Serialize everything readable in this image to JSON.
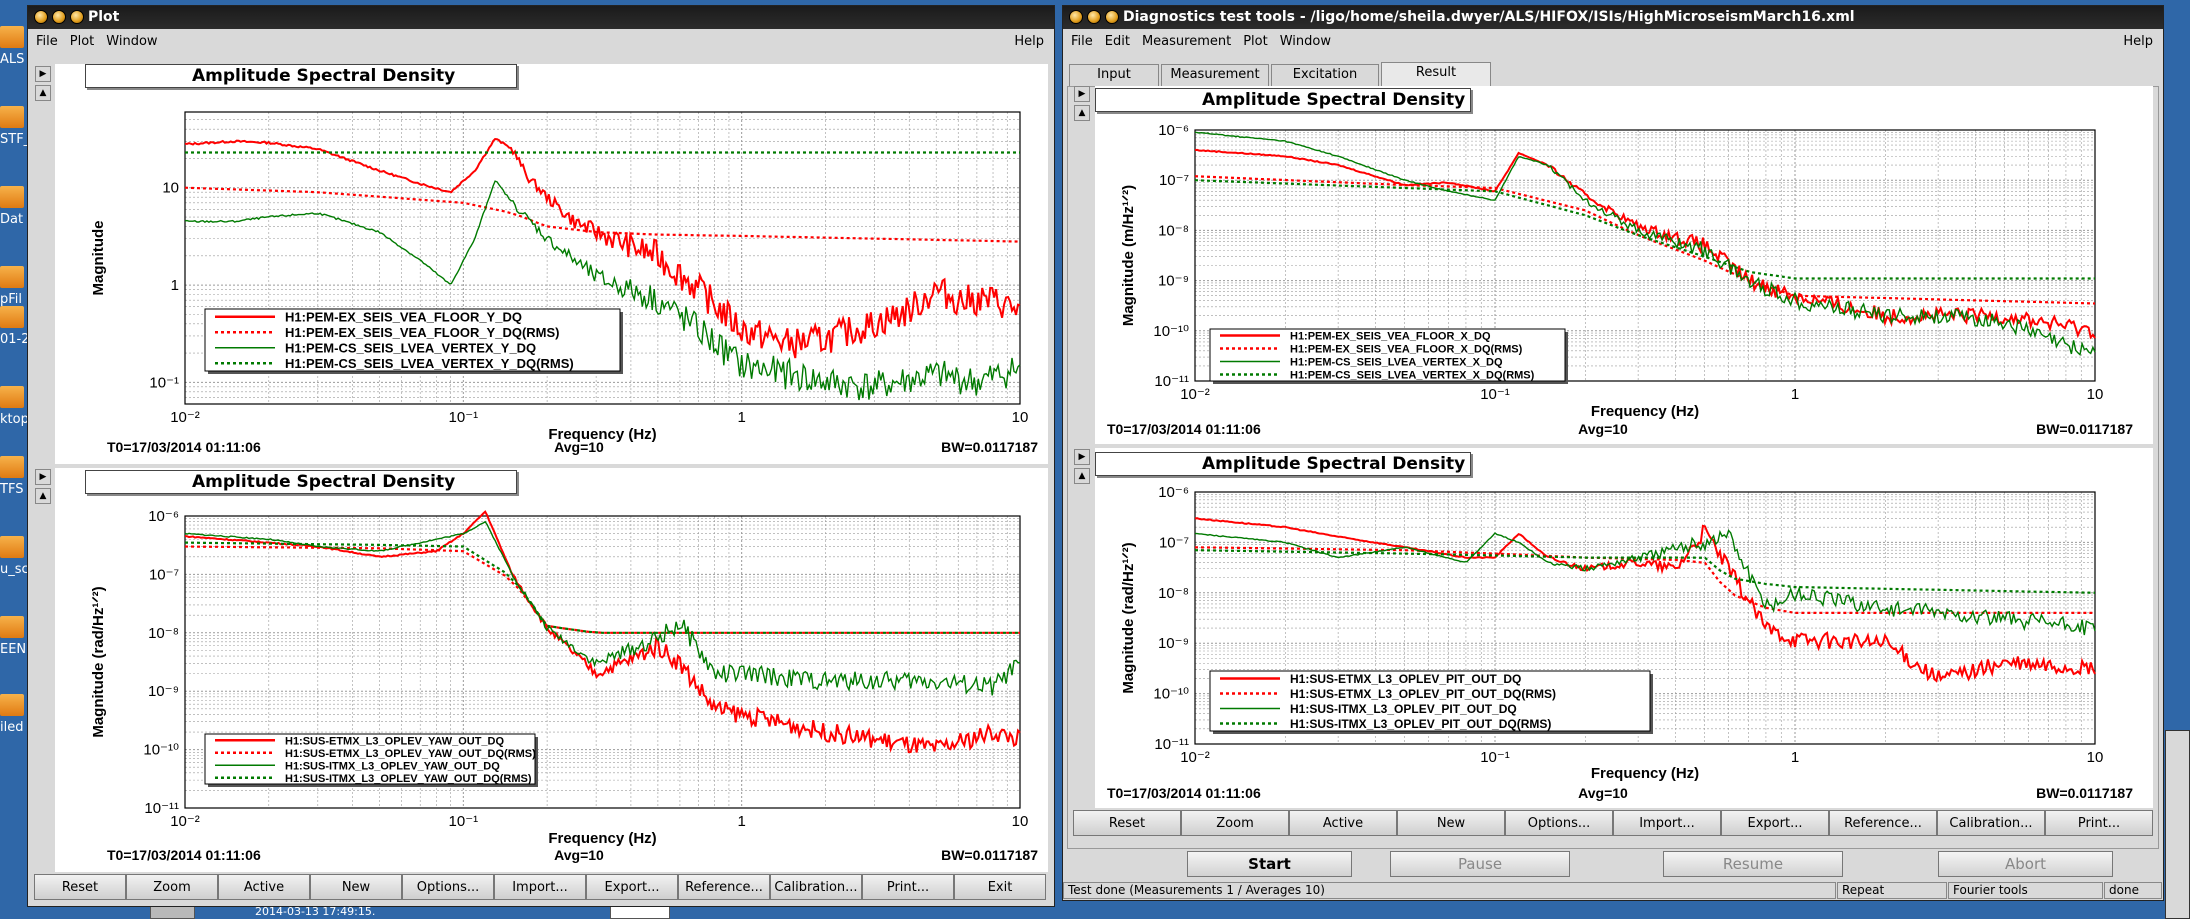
{
  "desktop": {
    "icons": [
      {
        "label": "ALS"
      },
      {
        "label": "STF_"
      },
      {
        "label": "Dat"
      },
      {
        "label": "pFil"
      },
      {
        "label": "01-2"
      },
      {
        "label": "ktop"
      },
      {
        "label": "TFS"
      },
      {
        "label": "u_sc"
      },
      {
        "label": "EENS"
      },
      {
        "label": "iled"
      }
    ],
    "taskbar_text": "2014-03-13 17:49:15."
  },
  "plot_window": {
    "title": "Plot",
    "menu": [
      "File",
      "Plot",
      "Window"
    ],
    "help": "Help",
    "buttons": [
      "Reset",
      "Zoom",
      "Active",
      "New",
      "Options...",
      "Import...",
      "Export...",
      "Reference...",
      "Calibration...",
      "Print...",
      "Exit"
    ],
    "panels": [
      {
        "title": "Amplitude Spectral Density",
        "ylabel": "Magnitude",
        "xlabel": "Frequency (Hz)",
        "yticks": [
          "10",
          "1",
          "10⁻¹"
        ],
        "xticks": [
          "10⁻²",
          "10⁻¹",
          "1",
          "10"
        ],
        "legend": [
          "H1:PEM-EX_SEIS_VEA_FLOOR_Y_DQ",
          "H1:PEM-EX_SEIS_VEA_FLOOR_Y_DQ(RMS)",
          "H1:PEM-CS_SEIS_LVEA_VERTEX_Y_DQ",
          "H1:PEM-CS_SEIS_LVEA_VERTEX_Y_DQ(RMS)"
        ],
        "t0": "T0=17/03/2014 01:11:06",
        "avg": "Avg=10",
        "bw": "BW=0.0117187"
      },
      {
        "title": "Amplitude Spectral Density",
        "ylabel": "Magnitude (rad/Hz¹ᐟ²)",
        "xlabel": "Frequency (Hz)",
        "yticks": [
          "10⁻⁶",
          "10⁻⁷",
          "10⁻⁸",
          "10⁻⁹",
          "10⁻¹⁰",
          "10⁻¹¹"
        ],
        "xticks": [
          "10⁻²",
          "10⁻¹",
          "1",
          "10"
        ],
        "legend": [
          "H1:SUS-ETMX_L3_OPLEV_YAW_OUT_DQ",
          "H1:SUS-ETMX_L3_OPLEV_YAW_OUT_DQ(RMS)",
          "H1:SUS-ITMX_L3_OPLEV_YAW_OUT_DQ",
          "H1:SUS-ITMX_L3_OPLEV_YAW_OUT_DQ(RMS)"
        ],
        "t0": "T0=17/03/2014 01:11:06",
        "avg": "Avg=10",
        "bw": "BW=0.0117187"
      }
    ]
  },
  "dtt_window": {
    "title": "Diagnostics test tools - /ligo/home/sheila.dwyer/ALS/HIFOX/ISIs/HighMicroseismMarch16.xml",
    "menu": [
      "File",
      "Edit",
      "Measurement",
      "Plot",
      "Window"
    ],
    "help": "Help",
    "tabs": [
      "Input",
      "Measurement",
      "Excitation",
      "Result"
    ],
    "buttons": [
      "Reset",
      "Zoom",
      "Active",
      "New",
      "Options...",
      "Import...",
      "Export...",
      "Reference...",
      "Calibration...",
      "Print..."
    ],
    "actions": [
      "Start",
      "Pause",
      "Resume",
      "Abort"
    ],
    "status": [
      "Test done (Measurements 1 / Averages 10)",
      "Repeat",
      "Fourier tools",
      "done"
    ],
    "panels": [
      {
        "title": "Amplitude Spectral Density",
        "ylabel": "Magnitude (m/Hz¹ᐟ²)",
        "xlabel": "Frequency (Hz)",
        "yticks": [
          "10⁻⁶",
          "10⁻⁷",
          "10⁻⁸",
          "10⁻⁹",
          "10⁻¹⁰",
          "10⁻¹¹"
        ],
        "xticks": [
          "10⁻²",
          "10⁻¹",
          "1",
          "10"
        ],
        "legend": [
          "H1:PEM-EX_SEIS_VEA_FLOOR_X_DQ",
          "H1:PEM-EX_SEIS_VEA_FLOOR_X_DQ(RMS)",
          "H1:PEM-CS_SEIS_LVEA_VERTEX_X_DQ",
          "H1:PEM-CS_SEIS_LVEA_VERTEX_X_DQ(RMS)"
        ],
        "t0": "T0=17/03/2014 01:11:06",
        "avg": "Avg=10",
        "bw": "BW=0.0117187"
      },
      {
        "title": "Amplitude Spectral Density",
        "ylabel": "Magnitude (rad/Hz¹ᐟ²)",
        "xlabel": "Frequency (Hz)",
        "yticks": [
          "10⁻⁶",
          "10⁻⁷",
          "10⁻⁸",
          "10⁻⁹",
          "10⁻¹⁰",
          "10⁻¹¹"
        ],
        "xticks": [
          "10⁻²",
          "10⁻¹",
          "1",
          "10"
        ],
        "legend": [
          "H1:SUS-ETMX_L3_OPLEV_PIT_OUT_DQ",
          "H1:SUS-ETMX_L3_OPLEV_PIT_OUT_DQ(RMS)",
          "H1:SUS-ITMX_L3_OPLEV_PIT_OUT_DQ",
          "H1:SUS-ITMX_L3_OPLEV_PIT_OUT_DQ(RMS)"
        ],
        "t0": "T0=17/03/2014 01:11:06",
        "avg": "Avg=10",
        "bw": "BW=0.0117187"
      }
    ]
  },
  "colors": {
    "red": "#ff0000",
    "green": "#007a00",
    "grid": "#9a9a9a"
  },
  "chart_data": [
    {
      "type": "line",
      "title": "Amplitude Spectral Density",
      "xlabel": "Frequency (Hz)",
      "ylabel": "Magnitude",
      "xscale": "log",
      "yscale": "log",
      "xlim": [
        0.01,
        10
      ],
      "ylim": [
        0.06,
        60
      ],
      "series": [
        {
          "name": "H1:PEM-EX_SEIS_VEA_FLOOR_Y_DQ",
          "style": "solid",
          "color": "red",
          "x": [
            0.01,
            0.015,
            0.02,
            0.03,
            0.05,
            0.07,
            0.09,
            0.11,
            0.13,
            0.15,
            0.17,
            0.2,
            0.25,
            0.3,
            0.4,
            0.5,
            0.7,
            1.0,
            1.5,
            2,
            3,
            4,
            5,
            6,
            8,
            10
          ],
          "y": [
            28,
            30,
            29,
            25,
            15,
            11,
            9,
            15,
            32,
            25,
            13,
            8,
            4.5,
            3.5,
            2.5,
            2,
            0.9,
            0.35,
            0.25,
            0.28,
            0.4,
            0.55,
            0.9,
            0.7,
            0.7,
            0.55
          ]
        },
        {
          "name": "H1:PEM-EX_SEIS_VEA_FLOOR_Y_DQ(RMS)",
          "style": "dotted",
          "color": "red",
          "x": [
            0.01,
            0.03,
            0.1,
            0.15,
            0.2,
            0.3,
            0.5,
            1,
            3,
            10
          ],
          "y": [
            10,
            9,
            7,
            5.5,
            4,
            3.5,
            3.3,
            3.2,
            3.0,
            2.8
          ]
        },
        {
          "name": "H1:PEM-CS_SEIS_LVEA_VERTEX_Y_DQ",
          "style": "solid",
          "color": "green",
          "x": [
            0.01,
            0.015,
            0.02,
            0.03,
            0.05,
            0.07,
            0.09,
            0.11,
            0.13,
            0.15,
            0.2,
            0.3,
            0.5,
            0.7,
            1,
            1.5,
            2,
            3,
            5,
            7,
            10
          ],
          "y": [
            4.5,
            4.5,
            5,
            5.5,
            3.5,
            1.8,
            1,
            3,
            12,
            7,
            3,
            1.2,
            0.7,
            0.35,
            0.15,
            0.12,
            0.1,
            0.09,
            0.12,
            0.1,
            0.14
          ]
        },
        {
          "name": "H1:PEM-CS_SEIS_LVEA_VERTEX_Y_DQ(RMS)",
          "style": "dotted",
          "color": "green",
          "x": [
            0.01,
            1,
            10
          ],
          "y": [
            23,
            23,
            23
          ]
        }
      ]
    },
    {
      "type": "line",
      "title": "Amplitude Spectral Density",
      "xlabel": "Frequency (Hz)",
      "ylabel": "Magnitude (rad/Hz¹ᐟ²)",
      "xscale": "log",
      "yscale": "log",
      "xlim": [
        0.01,
        10
      ],
      "ylim": [
        1e-11,
        1e-06
      ],
      "series": [
        {
          "name": "H1:SUS-ETMX_L3_OPLEV_YAW_OUT_DQ",
          "style": "solid",
          "color": "red",
          "x": [
            0.01,
            0.02,
            0.03,
            0.05,
            0.08,
            0.1,
            0.12,
            0.15,
            0.2,
            0.3,
            0.4,
            0.5,
            0.6,
            0.8,
            1,
            2,
            3,
            5,
            8,
            10
          ],
          "y": [
            4.5e-07,
            3.5e-07,
            3e-07,
            2e-07,
            2.5e-07,
            5e-07,
            1.2e-06,
            1e-07,
            1.2e-08,
            2e-09,
            3.5e-09,
            6e-09,
            3e-09,
            5e-10,
            4e-10,
            2e-10,
            1.5e-10,
            1e-10,
            2e-10,
            1.5e-10
          ]
        },
        {
          "name": "H1:SUS-ETMX_L3_OPLEV_YAW_OUT_DQ(RMS)",
          "style": "dotted",
          "color": "red",
          "x": [
            0.01,
            0.05,
            0.1,
            0.15,
            0.2,
            0.3,
            1,
            10
          ],
          "y": [
            3e-07,
            2.8e-07,
            2.5e-07,
            8e-08,
            1.3e-08,
            1e-08,
            1e-08,
            1e-08
          ]
        },
        {
          "name": "H1:SUS-ITMX_L3_OPLEV_YAW_OUT_DQ",
          "style": "solid",
          "color": "green",
          "x": [
            0.01,
            0.02,
            0.03,
            0.05,
            0.08,
            0.1,
            0.12,
            0.15,
            0.2,
            0.3,
            0.5,
            0.6,
            0.8,
            1,
            2,
            3,
            5,
            8,
            10
          ],
          "y": [
            5e-07,
            4e-07,
            3e-07,
            2.5e-07,
            4e-07,
            5e-07,
            8e-07,
            1e-07,
            1.2e-08,
            3e-09,
            8e-09,
            1.5e-08,
            2e-09,
            2e-09,
            1.5e-09,
            1.5e-09,
            1.5e-09,
            1.2e-09,
            3e-09
          ]
        },
        {
          "name": "H1:SUS-ITMX_L3_OPLEV_YAW_OUT_DQ(RMS)",
          "style": "dotted",
          "color": "green",
          "x": [
            0.01,
            0.05,
            0.1,
            0.15,
            0.2,
            0.3,
            1,
            10
          ],
          "y": [
            3.5e-07,
            3.2e-07,
            3e-07,
            9e-08,
            1.3e-08,
            1e-08,
            1e-08,
            1e-08
          ]
        }
      ]
    },
    {
      "type": "line",
      "title": "Amplitude Spectral Density",
      "xlabel": "Frequency (Hz)",
      "ylabel": "Magnitude (m/Hz¹ᐟ²)",
      "xscale": "log",
      "yscale": "log",
      "xlim": [
        0.01,
        10
      ],
      "ylim": [
        1e-11,
        1e-06
      ],
      "series": [
        {
          "name": "H1:PEM-EX_SEIS_VEA_FLOOR_X_DQ",
          "style": "solid",
          "color": "red",
          "x": [
            0.01,
            0.02,
            0.03,
            0.05,
            0.07,
            0.1,
            0.12,
            0.15,
            0.2,
            0.3,
            0.5,
            0.7,
            1,
            2,
            3,
            5,
            10
          ],
          "y": [
            4e-07,
            3e-07,
            2e-07,
            8e-08,
            9e-08,
            6e-08,
            3.5e-07,
            2e-07,
            5e-08,
            1.2e-08,
            5e-09,
            1e-09,
            5e-10,
            2e-10,
            2e-10,
            2e-10,
            1e-10
          ]
        },
        {
          "name": "H1:PEM-EX_SEIS_VEA_FLOOR_X_DQ(RMS)",
          "style": "dotted",
          "color": "red",
          "x": [
            0.01,
            0.05,
            0.1,
            0.2,
            0.3,
            0.5,
            0.7,
            1,
            10
          ],
          "y": [
            1.2e-07,
            8e-08,
            7e-08,
            2.5e-08,
            8e-09,
            2.5e-09,
            1e-09,
            5e-10,
            3.5e-10
          ]
        },
        {
          "name": "H1:PEM-CS_SEIS_LVEA_VERTEX_X_DQ",
          "style": "solid",
          "color": "green",
          "x": [
            0.01,
            0.02,
            0.03,
            0.05,
            0.07,
            0.1,
            0.12,
            0.15,
            0.2,
            0.3,
            0.5,
            0.7,
            1,
            2,
            3,
            5,
            8,
            10
          ],
          "y": [
            9e-07,
            6e-07,
            3e-07,
            1e-07,
            6e-08,
            4e-08,
            3e-07,
            2e-07,
            4e-08,
            1e-08,
            4e-09,
            1e-09,
            4e-10,
            2e-10,
            2e-10,
            1.5e-10,
            5e-11,
            4e-11
          ]
        },
        {
          "name": "H1:PEM-CS_SEIS_LVEA_VERTEX_X_DQ(RMS)",
          "style": "dotted",
          "color": "green",
          "x": [
            0.01,
            0.05,
            0.1,
            0.2,
            0.3,
            0.5,
            0.7,
            1,
            10
          ],
          "y": [
            1e-07,
            7e-08,
            6e-08,
            2e-08,
            8e-09,
            3e-09,
            1.5e-09,
            1.1e-09,
            1.1e-09
          ]
        }
      ]
    },
    {
      "type": "line",
      "title": "Amplitude Spectral Density",
      "xlabel": "Frequency (Hz)",
      "ylabel": "Magnitude (rad/Hz¹ᐟ²)",
      "xscale": "log",
      "yscale": "log",
      "xlim": [
        0.01,
        10
      ],
      "ylim": [
        1e-11,
        1e-06
      ],
      "series": [
        {
          "name": "H1:SUS-ETMX_L3_OPLEV_PIT_OUT_DQ",
          "style": "solid",
          "color": "red",
          "x": [
            0.01,
            0.02,
            0.03,
            0.05,
            0.08,
            0.1,
            0.12,
            0.15,
            0.2,
            0.3,
            0.4,
            0.5,
            0.6,
            0.8,
            1,
            2,
            3,
            5,
            10
          ],
          "y": [
            3e-07,
            2e-07,
            1.3e-07,
            8e-08,
            5e-08,
            5e-08,
            1.5e-07,
            5e-08,
            3e-08,
            4e-08,
            3e-08,
            1.7e-07,
            3e-08,
            2e-09,
            1.2e-09,
            1e-09,
            2e-10,
            4e-10,
            3e-10
          ]
        },
        {
          "name": "H1:SUS-ETMX_L3_OPLEV_PIT_OUT_DQ(RMS)",
          "style": "dotted",
          "color": "red",
          "x": [
            0.01,
            0.05,
            0.1,
            0.2,
            0.4,
            0.5,
            0.6,
            0.8,
            1,
            10
          ],
          "y": [
            8e-08,
            7e-08,
            6e-08,
            5e-08,
            4.5e-08,
            4e-08,
            1e-08,
            5e-09,
            4e-09,
            4e-09
          ]
        },
        {
          "name": "H1:SUS-ITMX_L3_OPLEV_PIT_OUT_DQ",
          "style": "solid",
          "color": "green",
          "x": [
            0.01,
            0.02,
            0.03,
            0.05,
            0.08,
            0.1,
            0.12,
            0.15,
            0.2,
            0.3,
            0.5,
            0.6,
            0.8,
            1,
            2,
            3,
            5,
            10
          ],
          "y": [
            1.5e-07,
            1e-07,
            5e-08,
            8e-08,
            4e-08,
            1.5e-07,
            1e-07,
            4e-08,
            3e-08,
            5e-08,
            1e-07,
            1.5e-07,
            5e-09,
            1e-08,
            5e-09,
            4e-09,
            3e-09,
            2e-09
          ]
        },
        {
          "name": "H1:SUS-ITMX_L3_OPLEV_PIT_OUT_DQ(RMS)",
          "style": "dotted",
          "color": "green",
          "x": [
            0.01,
            0.05,
            0.1,
            0.2,
            0.4,
            0.5,
            0.6,
            0.8,
            1,
            10
          ],
          "y": [
            7e-08,
            6e-08,
            5.5e-08,
            5e-08,
            5e-08,
            5e-08,
            2e-08,
            1.5e-08,
            1.3e-08,
            1e-08
          ]
        }
      ]
    }
  ]
}
